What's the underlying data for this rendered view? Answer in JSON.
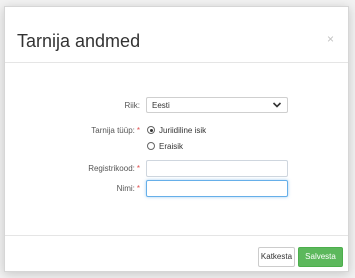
{
  "dialog": {
    "title": "Tarnija andmed",
    "close_glyph": "×"
  },
  "form": {
    "country": {
      "label": "Riik:",
      "value": "Eesti"
    },
    "supplier_type": {
      "label": "Tarnija tüüp:",
      "required_mark": "*",
      "options": [
        {
          "label": "Juriidiline isik",
          "selected": true
        },
        {
          "label": "Eraisik",
          "selected": false
        }
      ]
    },
    "registry_code": {
      "label": "Registrikood:",
      "required_mark": "*",
      "value": ""
    },
    "name": {
      "label": "Nimi:",
      "required_mark": "*",
      "value": ""
    }
  },
  "footer": {
    "cancel_label": "Katkesta",
    "save_label": "Salvesta"
  },
  "colors": {
    "save_button": "#5cb85c",
    "required": "#e05050",
    "focus_border": "#66afe9"
  },
  "icons": {
    "close": "close-icon",
    "select": "chevron-down-icon"
  }
}
